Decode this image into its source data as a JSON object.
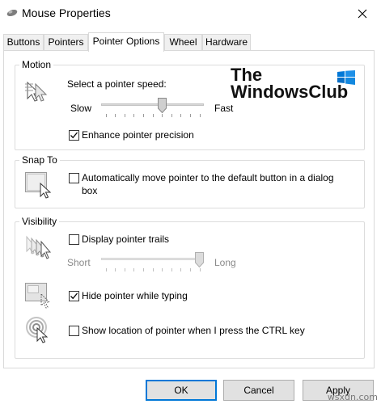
{
  "window": {
    "title": "Mouse Properties"
  },
  "tabs": [
    {
      "label": "Buttons"
    },
    {
      "label": "Pointers"
    },
    {
      "label": "Pointer Options",
      "active": true
    },
    {
      "label": "Wheel"
    },
    {
      "label": "Hardware"
    }
  ],
  "motion": {
    "group_label": "Motion",
    "speed_label": "Select a pointer speed:",
    "slow_label": "Slow",
    "fast_label": "Fast",
    "speed_value_fraction": 0.6,
    "precision_label": "Enhance pointer precision",
    "precision_checked": true
  },
  "logo": {
    "line1": "The",
    "line2": "WindowsClub"
  },
  "snap_to": {
    "group_label": "Snap To",
    "auto_move_label_line1": "Automatically move pointer to the default button in a dialog",
    "auto_move_label_line2": "box",
    "auto_move_checked": false
  },
  "visibility": {
    "group_label": "Visibility",
    "trails_label": "Display pointer trails",
    "trails_checked": false,
    "short_label": "Short",
    "long_label": "Long",
    "trails_value_fraction": 1.0,
    "hide_label": "Hide pointer while typing",
    "hide_checked": true,
    "ctrl_label": "Show location of pointer when I press the CTRL key",
    "ctrl_checked": false
  },
  "footer": {
    "ok_label": "OK",
    "cancel_label": "Cancel",
    "apply_label": "Apply"
  },
  "watermark": "wsxdn.com",
  "colors": {
    "accent": "#0078d7",
    "logo_blue": "#0078d7"
  }
}
